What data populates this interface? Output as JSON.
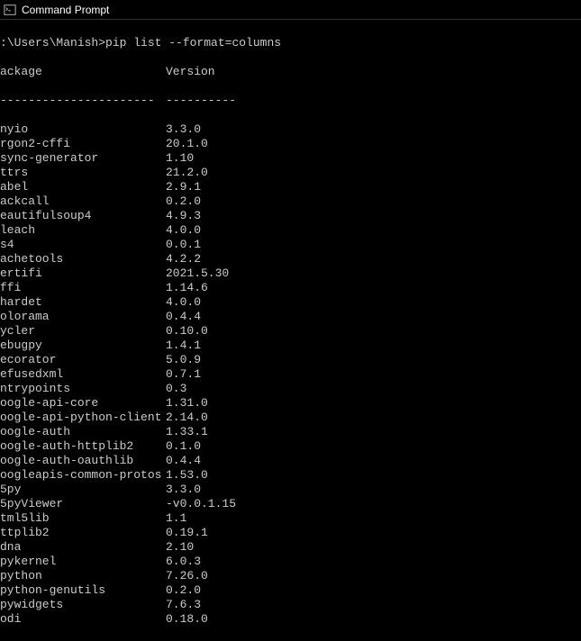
{
  "titlebar": {
    "title": "Command Prompt"
  },
  "prompt": ":\\Users\\Manish>pip list --format=columns",
  "headers": {
    "package": "ackage",
    "version": "Version"
  },
  "separator": {
    "package": "----------------------",
    "version": "----------"
  },
  "packages": [
    {
      "name": "nyio",
      "version": "3.3.0"
    },
    {
      "name": "rgon2-cffi",
      "version": "20.1.0"
    },
    {
      "name": "sync-generator",
      "version": "1.10"
    },
    {
      "name": "ttrs",
      "version": "21.2.0"
    },
    {
      "name": "abel",
      "version": "2.9.1"
    },
    {
      "name": "ackcall",
      "version": "0.2.0"
    },
    {
      "name": "eautifulsoup4",
      "version": "4.9.3"
    },
    {
      "name": "leach",
      "version": "4.0.0"
    },
    {
      "name": "s4",
      "version": "0.0.1"
    },
    {
      "name": "achetools",
      "version": "4.2.2"
    },
    {
      "name": "ertifi",
      "version": "2021.5.30"
    },
    {
      "name": "ffi",
      "version": "1.14.6"
    },
    {
      "name": "hardet",
      "version": "4.0.0"
    },
    {
      "name": "olorama",
      "version": "0.4.4"
    },
    {
      "name": "ycler",
      "version": "0.10.0"
    },
    {
      "name": "ebugpy",
      "version": "1.4.1"
    },
    {
      "name": "ecorator",
      "version": "5.0.9"
    },
    {
      "name": "efusedxml",
      "version": "0.7.1"
    },
    {
      "name": "ntrypoints",
      "version": "0.3"
    },
    {
      "name": "oogle-api-core",
      "version": "1.31.0"
    },
    {
      "name": "oogle-api-python-client",
      "version": "2.14.0"
    },
    {
      "name": "oogle-auth",
      "version": "1.33.1"
    },
    {
      "name": "oogle-auth-httplib2",
      "version": "0.1.0"
    },
    {
      "name": "oogle-auth-oauthlib",
      "version": "0.4.4"
    },
    {
      "name": "oogleapis-common-protos",
      "version": "1.53.0"
    },
    {
      "name": "5py",
      "version": "3.3.0"
    },
    {
      "name": "5pyViewer",
      "version": "-v0.0.1.15"
    },
    {
      "name": "tml5lib",
      "version": "1.1"
    },
    {
      "name": "ttplib2",
      "version": "0.19.1"
    },
    {
      "name": "dna",
      "version": "2.10"
    },
    {
      "name": "pykernel",
      "version": "6.0.3"
    },
    {
      "name": "python",
      "version": "7.26.0"
    },
    {
      "name": "python-genutils",
      "version": "0.2.0"
    },
    {
      "name": "pywidgets",
      "version": "7.6.3"
    },
    {
      "name": "odi",
      "version": "0.18.0"
    }
  ]
}
